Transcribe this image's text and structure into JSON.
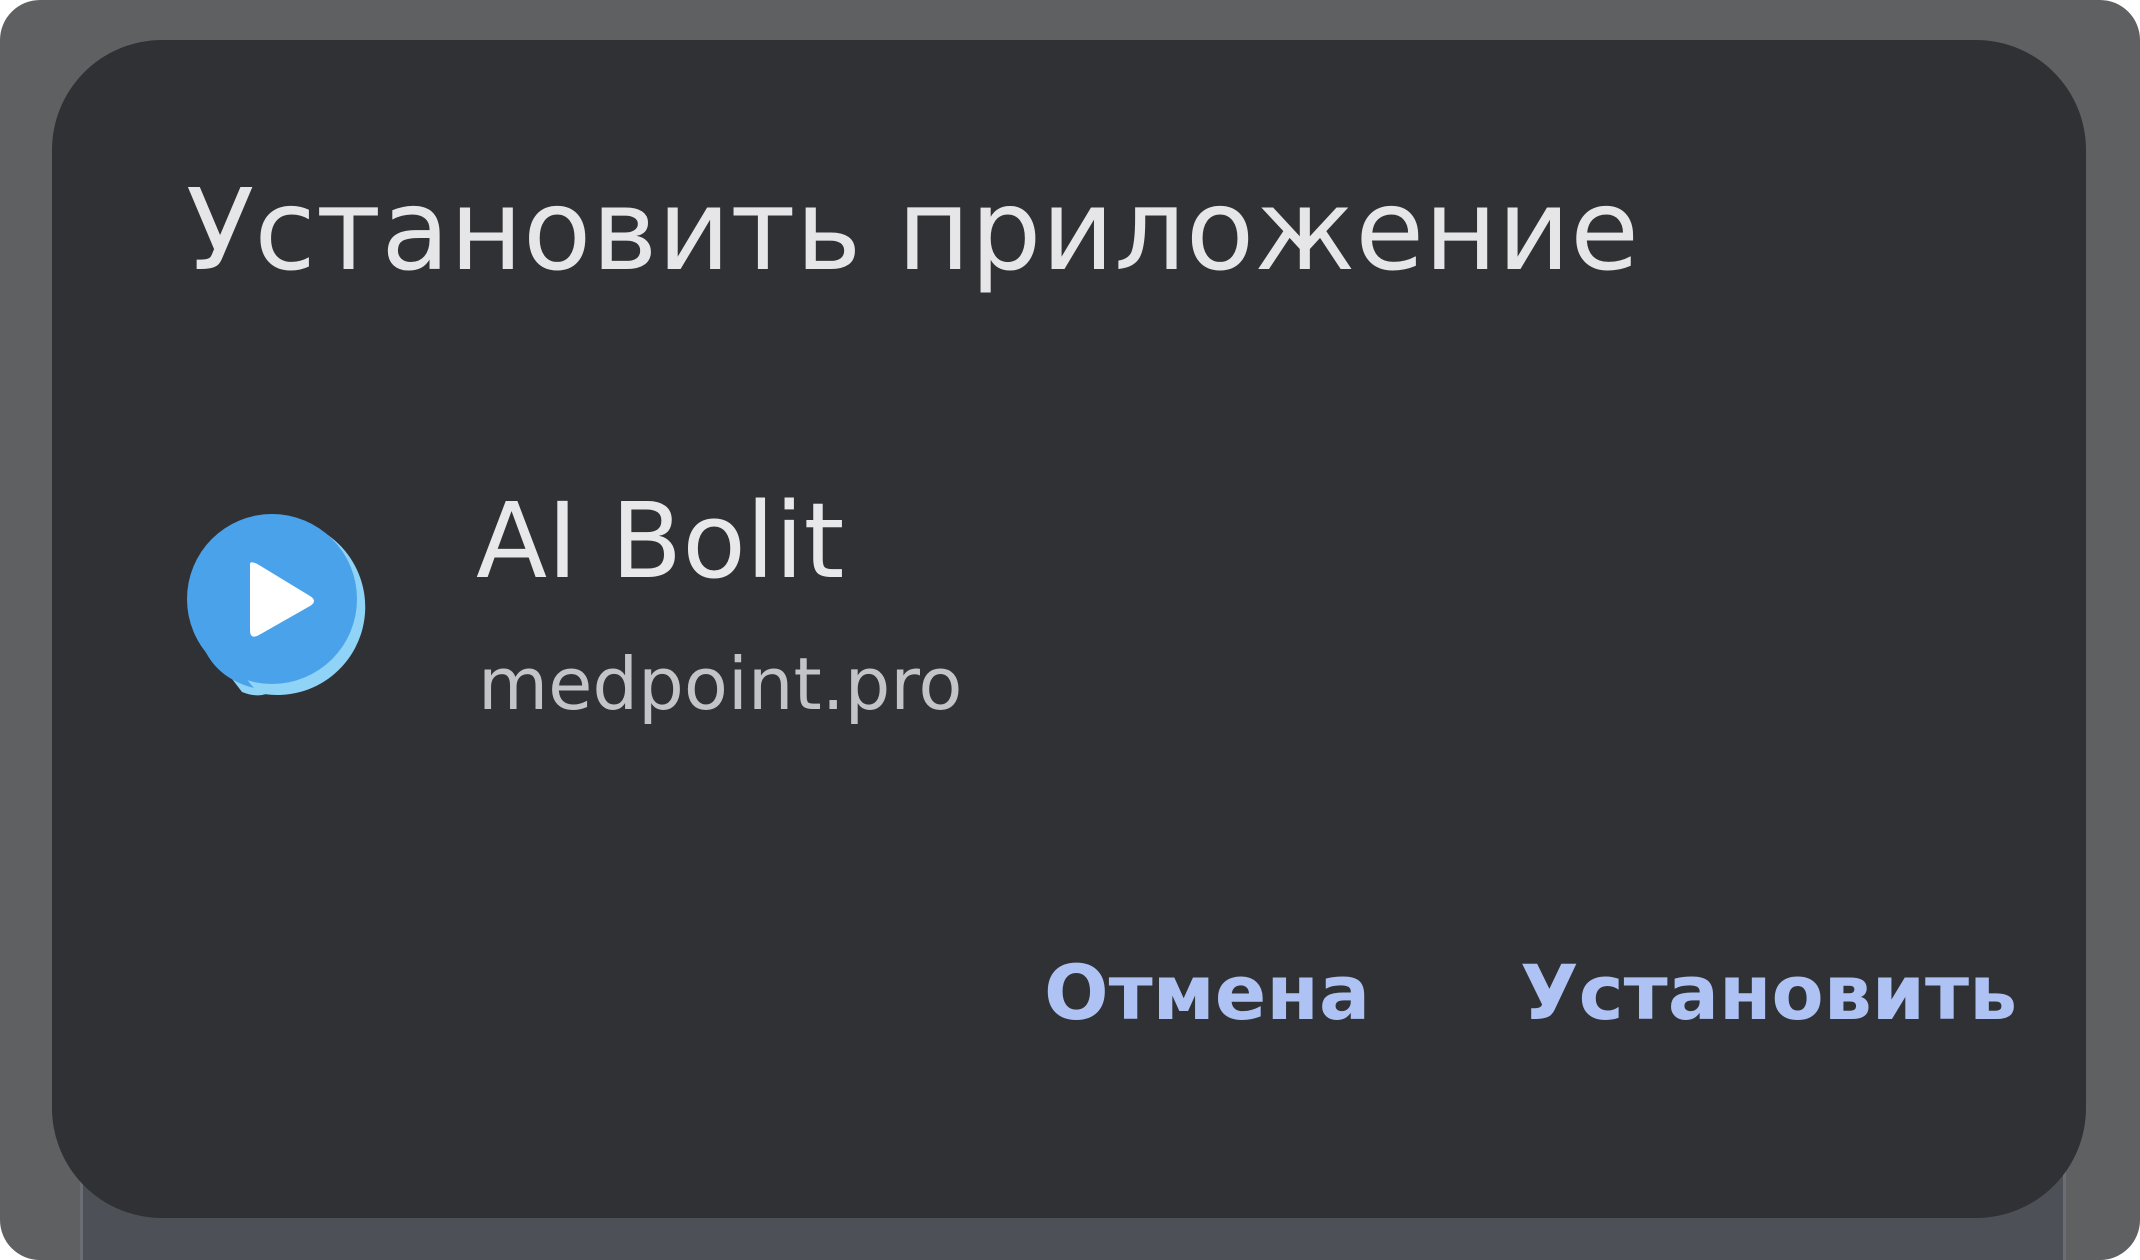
{
  "dialog": {
    "title": "Установить приложение",
    "app": {
      "name": "AI Bolit",
      "source": "medpoint.pro",
      "icon": "play-chat-bubble-icon"
    },
    "buttons": {
      "cancel_label": "Отмена",
      "install_label": "Установить"
    }
  },
  "colors": {
    "dialog_background": "#303135",
    "scrim": "#5f6062",
    "title_text": "#e6e6e9",
    "secondary_text": "#c3c4c8",
    "button_text": "#aec3f4",
    "icon_blue": "#4aa3ea",
    "icon_light_blue": "#8fd3f7"
  }
}
